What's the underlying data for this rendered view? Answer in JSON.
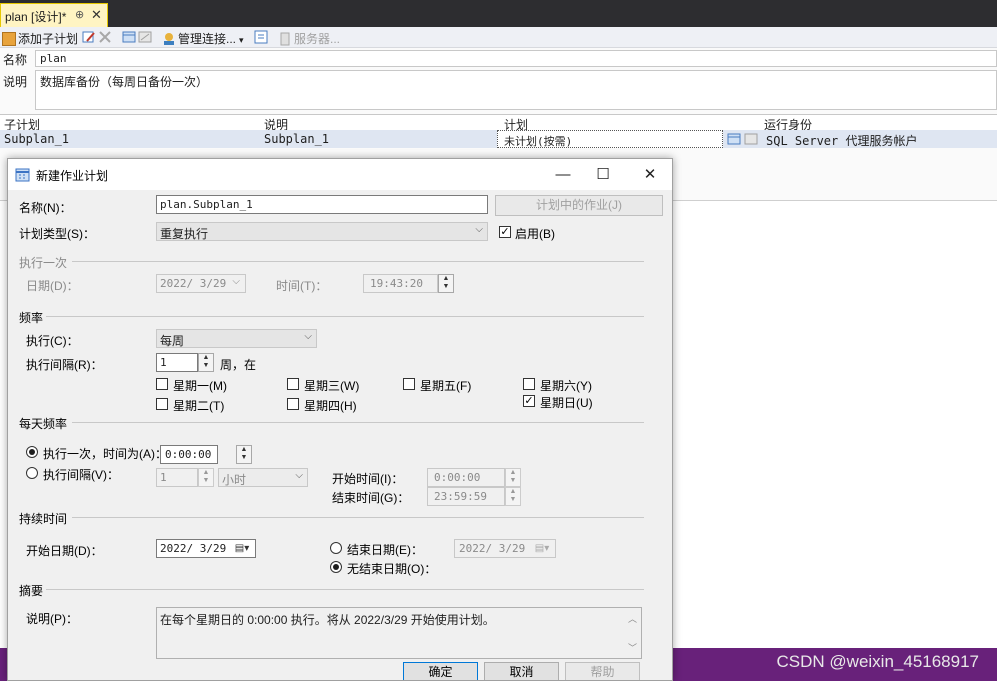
{
  "ide": {
    "tab_title": "plan [设计]*",
    "tab_pin": "⊕",
    "tab_close": "✕",
    "toolbar": {
      "add_subplan": "添加子计划",
      "manage_connections": "管理连接...",
      "servers": "服务器..."
    },
    "name_label": "名称",
    "name_value": "plan",
    "desc_label": "说明",
    "desc_value": "数据库备份（每周日备份一次）",
    "grid": {
      "headers": [
        "子计划",
        "说明",
        "计划",
        "运行身份"
      ],
      "row": [
        "Subplan_1",
        "Subplan_1",
        "未计划(按需)",
        "SQL Server 代理服务帐户"
      ]
    },
    "watermark": "CSDN @weixin_45168917"
  },
  "dialog": {
    "title": "新建作业计划",
    "minimize": "—",
    "maximize": "☐",
    "close": "✕",
    "name_label": "名称(N)：",
    "name_value": "plan.Subplan_1",
    "jobs_button": "计划中的作业(J)",
    "type_label": "计划类型(S)：",
    "type_value": "重复执行",
    "enabled_label": "启用(B)",
    "once": {
      "section": "执行一次",
      "date_label": "日期(D)：",
      "date_value": "2022/ 3/29",
      "time_label": "时间(T)：",
      "time_value": "19:43:20"
    },
    "frequency": {
      "section": "频率",
      "occurs_label": "执行(C)：",
      "occurs_value": "每周",
      "recur_label": "执行间隔(R)：",
      "recur_value": "1",
      "recur_suffix": "周，在",
      "days": [
        {
          "label": "星期一(M)",
          "checked": false
        },
        {
          "label": "星期二(T)",
          "checked": false
        },
        {
          "label": "星期三(W)",
          "checked": false
        },
        {
          "label": "星期四(H)",
          "checked": false
        },
        {
          "label": "星期五(F)",
          "checked": false
        },
        {
          "label": "星期六(Y)",
          "checked": false
        },
        {
          "label": "星期日(U)",
          "checked": true
        }
      ]
    },
    "daily": {
      "section": "每天频率",
      "once_at_label": "执行一次，时间为(A)：",
      "once_at_value": "0:00:00",
      "every_label": "执行间隔(V)：",
      "every_value": "1",
      "every_unit": "小时",
      "start_label": "开始时间(I)：",
      "start_value": "0:00:00",
      "end_label": "结束时间(G)：",
      "end_value": "23:59:59"
    },
    "duration": {
      "section": "持续时间",
      "start_label": "开始日期(D)：",
      "start_value": "2022/ 3/29",
      "end_label": "结束日期(E)：",
      "end_value": "2022/ 3/29",
      "no_end_label": "无结束日期(O)："
    },
    "summary": {
      "section": "摘要",
      "desc_label": "说明(P)：",
      "desc_value": "在每个星期日的 0:00:00 执行。将从 2022/3/29 开始使用计划。"
    },
    "ok": "确定",
    "cancel": "取消",
    "help": "帮助"
  }
}
